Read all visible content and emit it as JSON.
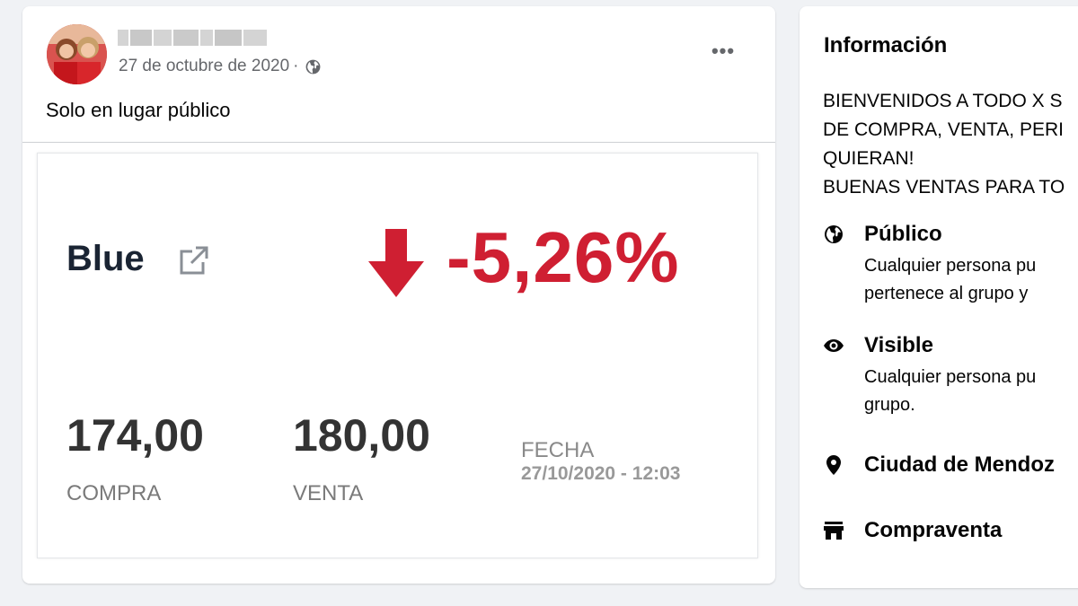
{
  "post": {
    "date": "27 de octubre de 2020",
    "separator": "·",
    "privacy_icon": "globe-icon",
    "more_icon": "more-options-icon",
    "more_label": "•••",
    "text": "Solo en lugar público"
  },
  "rate_card": {
    "name": "Blue",
    "link_icon": "external-link-icon",
    "trend_icon": "arrow-down-icon",
    "change": "-5,26%",
    "buy_value": "174,00",
    "buy_label": "COMPRA",
    "sell_value": "180,00",
    "sell_label": "VENTA",
    "date_label": "FECHA",
    "date_value": "27/10/2020 - 12:03",
    "accent_color": "#cf1f32"
  },
  "info": {
    "title": "Información",
    "description": [
      "BIENVENIDOS A TODO X S",
      "DE COMPRA, VENTA, PERI",
      "QUIERAN!",
      "BUENAS VENTAS PARA TO"
    ],
    "items": [
      {
        "icon": "globe-icon",
        "title": "Público",
        "lines": [
          "Cualquier persona pu",
          "pertenece al grupo y"
        ]
      },
      {
        "icon": "eye-icon",
        "title": "Visible",
        "lines": [
          "Cualquier persona pu",
          "grupo."
        ]
      },
      {
        "icon": "location-pin-icon",
        "title": "Ciudad de Mendoz",
        "lines": []
      },
      {
        "icon": "shop-icon",
        "title": "Compraventa",
        "lines": []
      }
    ]
  }
}
